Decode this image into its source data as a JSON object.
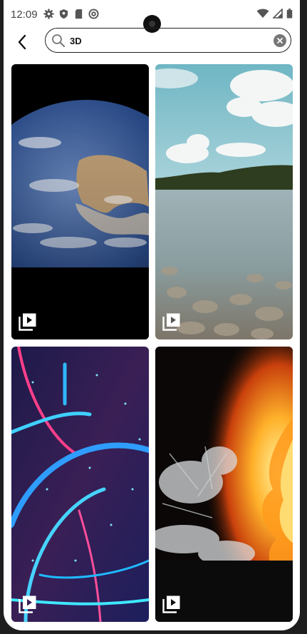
{
  "status_bar": {
    "time": "12:09"
  },
  "search": {
    "query": "3D"
  },
  "results": [
    {
      "kind": "video",
      "subject": "earth"
    },
    {
      "kind": "video",
      "subject": "river"
    },
    {
      "kind": "video",
      "subject": "neon"
    },
    {
      "kind": "video",
      "subject": "fire-water"
    }
  ],
  "colors": {
    "background": "#ffffff",
    "text": "#111111",
    "status_text": "#444444"
  }
}
